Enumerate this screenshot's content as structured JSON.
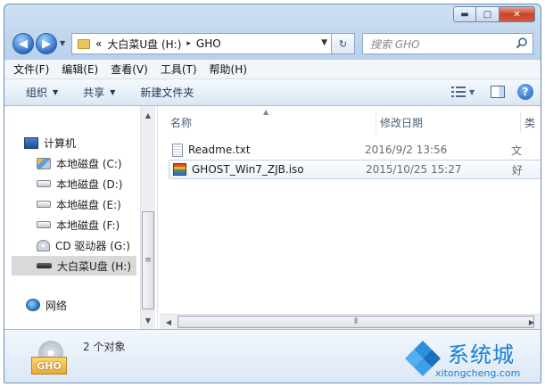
{
  "window": {
    "caption_min": "▬",
    "caption_max": "□",
    "caption_close": "✕"
  },
  "address": {
    "overflow": "«",
    "path": [
      "大白菜U盘 (H:)",
      "GHO"
    ],
    "separator": "▸",
    "search_placeholder": "搜索 GHO"
  },
  "menu": [
    "文件(F)",
    "编辑(E)",
    "查看(V)",
    "工具(T)",
    "帮助(H)"
  ],
  "commands": {
    "organize": "组织",
    "share": "共享",
    "new_folder": "新建文件夹"
  },
  "nav": {
    "computer": "计算机",
    "drives": [
      {
        "label": "本地磁盘 (C:)",
        "icon": "system-drive-icon"
      },
      {
        "label": "本地磁盘 (D:)",
        "icon": "hard-drive-icon"
      },
      {
        "label": "本地磁盘 (E:)",
        "icon": "hard-drive-icon"
      },
      {
        "label": "本地磁盘 (F:)",
        "icon": "hard-drive-icon"
      },
      {
        "label": "CD 驱动器 (G:)",
        "icon": "cd-drive-icon"
      },
      {
        "label": "大白菜U盘 (H:)",
        "icon": "usb-drive-icon",
        "selected": true
      }
    ],
    "network": "网络"
  },
  "columns": {
    "name": "名称",
    "date": "修改日期",
    "type": "类"
  },
  "files": [
    {
      "name": "Readme.txt",
      "date": "2016/9/2 13:56",
      "type": "文",
      "icon": "text-file-icon"
    },
    {
      "name": "GHOST_Win7_ZJB.iso",
      "date": "2015/10/25 15:27",
      "type": "好",
      "icon": "iso-file-icon",
      "selected": true
    }
  ],
  "details": {
    "icon_label": "GHO",
    "count": "2 个对象"
  },
  "watermark": {
    "title": "系统城",
    "url": "xitongcheng.com"
  }
}
